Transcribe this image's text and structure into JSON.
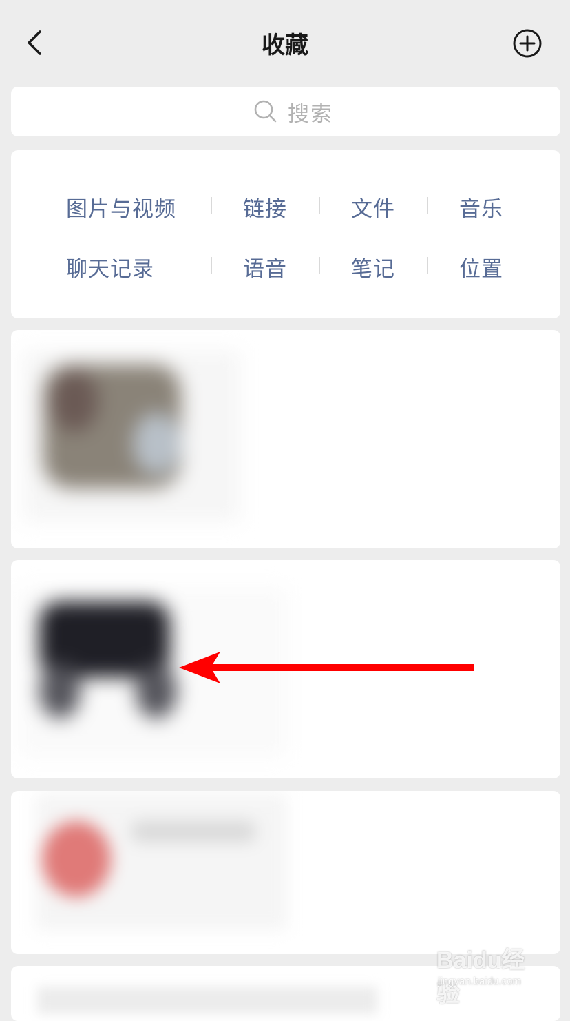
{
  "header": {
    "title": "收藏"
  },
  "search": {
    "placeholder": "搜索"
  },
  "categories": {
    "row1": [
      "图片与视频",
      "链接",
      "文件",
      "音乐"
    ],
    "row2": [
      "聊天记录",
      "语音",
      "笔记",
      "位置"
    ]
  },
  "watermark": {
    "brand": "Baidu经验",
    "url": "jingyan.baidu.com"
  },
  "colors": {
    "link": "#576b95",
    "background": "#ededed",
    "arrow": "#ff0000"
  }
}
